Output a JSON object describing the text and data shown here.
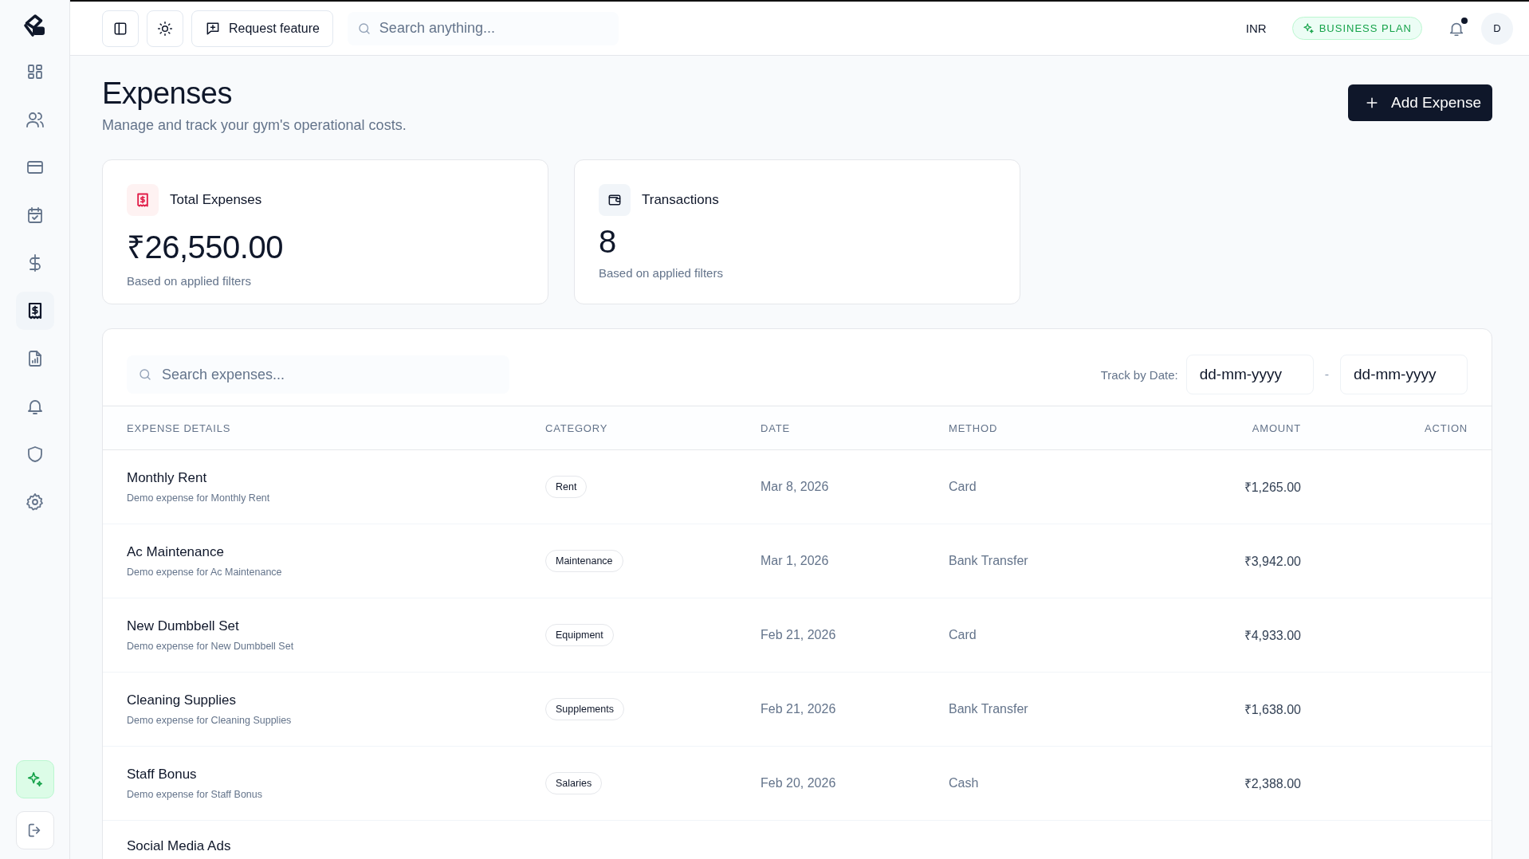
{
  "topbar": {
    "request_feature": "Request feature",
    "search": {
      "placeholder": "Search anything..."
    },
    "currency": "INR",
    "plan": "BUSINESS PLAN",
    "notification_dot": true,
    "avatar": "D"
  },
  "sidebar": {
    "items": [
      {
        "kind": "grid",
        "selected": false
      },
      {
        "kind": "users",
        "selected": false
      },
      {
        "kind": "card",
        "selected": false
      },
      {
        "kind": "calendar",
        "selected": false
      },
      {
        "kind": "dollar",
        "selected": false
      },
      {
        "kind": "receipt",
        "selected": true
      },
      {
        "kind": "report",
        "selected": false
      },
      {
        "kind": "bell",
        "selected": false
      },
      {
        "kind": "shield",
        "selected": false
      },
      {
        "kind": "gear",
        "selected": false
      }
    ],
    "bottom": [
      {
        "kind": "sparkle"
      },
      {
        "kind": "logout"
      }
    ]
  },
  "page": {
    "title": "Expenses",
    "subtitle": "Manage and track your gym's operational costs.",
    "add_button": "Add Expense"
  },
  "stats": [
    {
      "kind": "expense",
      "label": "Total Expenses",
      "value": "₹26,550.00",
      "note": "Based on applied filters"
    },
    {
      "kind": "transactions",
      "label": "Transactions",
      "value": "8",
      "note": "Based on applied filters"
    }
  ],
  "table": {
    "search": {
      "placeholder": "Search expenses..."
    },
    "date_label": "Track by Date:",
    "date_from": {
      "placeholder": "dd-mm-yyyy"
    },
    "date_separator": "-",
    "date_to": {
      "placeholder": "dd-mm-yyyy"
    },
    "columns": [
      "EXPENSE DETAILS",
      "CATEGORY",
      "DATE",
      "METHOD",
      "AMOUNT",
      "ACTION"
    ],
    "rows": [
      {
        "name": "Monthly Rent",
        "description": "Demo expense for Monthly Rent",
        "category": "Rent",
        "date": "Mar 8, 2026",
        "method": "Card",
        "amount": "₹1,265.00"
      },
      {
        "name": "Ac Maintenance",
        "description": "Demo expense for Ac Maintenance",
        "category": "Maintenance",
        "date": "Mar 1, 2026",
        "method": "Bank Transfer",
        "amount": "₹3,942.00"
      },
      {
        "name": "New Dumbbell Set",
        "description": "Demo expense for New Dumbbell Set",
        "category": "Equipment",
        "date": "Feb 21, 2026",
        "method": "Card",
        "amount": "₹4,933.00"
      },
      {
        "name": "Cleaning Supplies",
        "description": "Demo expense for Cleaning Supplies",
        "category": "Supplements",
        "date": "Feb 21, 2026",
        "method": "Bank Transfer",
        "amount": "₹1,638.00"
      },
      {
        "name": "Staff Bonus",
        "description": "Demo expense for Staff Bonus",
        "category": "Salaries",
        "date": "Feb 20, 2026",
        "method": "Cash",
        "amount": "₹2,388.00"
      },
      {
        "name": "Social Media Ads"
      }
    ]
  }
}
